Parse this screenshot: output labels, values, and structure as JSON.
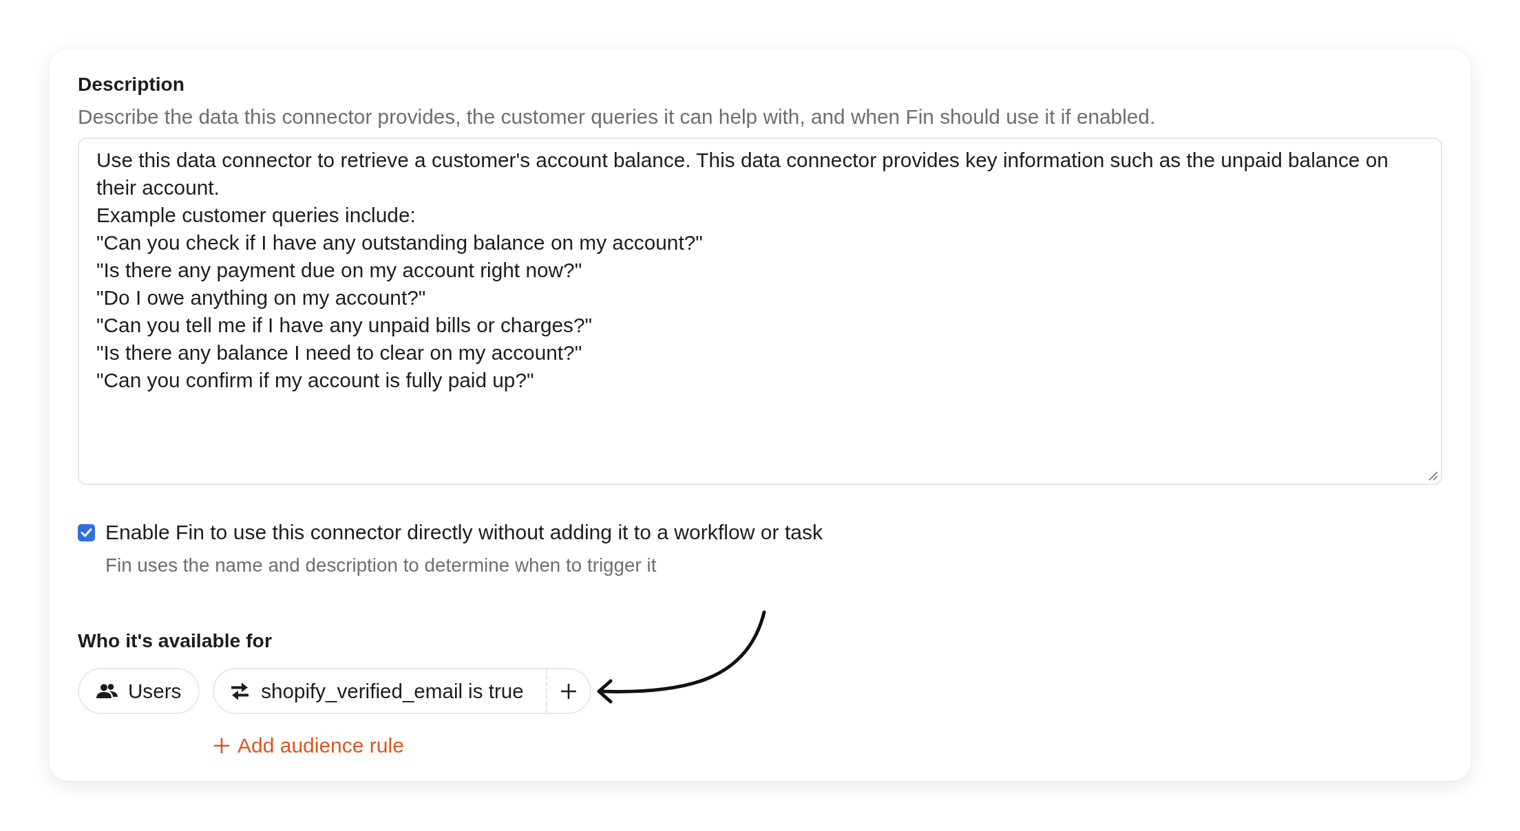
{
  "description": {
    "label": "Description",
    "hint": "Describe the data this connector provides, the customer queries it can help with, and when Fin should use it if enabled.",
    "value": "Use this data connector to retrieve a customer's account balance. This data connector provides key information such as the unpaid balance on their account.\nExample customer queries include:\n\"Can you check if I have any outstanding balance on my account?\"\n\"Is there any payment due on my account right now?\"\n\"Do I owe anything on my account?\"\n\"Can you tell me if I have any unpaid bills or charges?\"\n\"Is there any balance I need to clear on my account?\"\n\"Can you confirm if my account is fully paid up?\""
  },
  "direct_use": {
    "label": "Enable Fin to use this connector directly without adding it to a workflow or task",
    "hint": "Fin uses the name and description to determine when to trigger it",
    "checked": true
  },
  "audience": {
    "title": "Who it's available for",
    "chips": [
      {
        "kind": "audience",
        "label": "Users"
      },
      {
        "kind": "rule",
        "attribute": "shopify_verified_email",
        "condition": "is true"
      }
    ],
    "add_rule": {
      "label": "Add audience rule"
    }
  }
}
